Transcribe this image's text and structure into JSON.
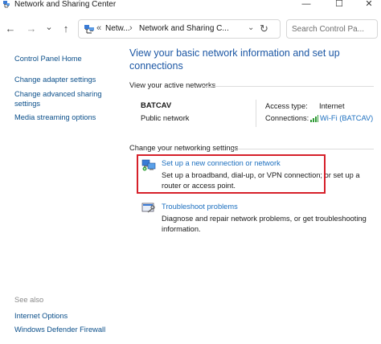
{
  "window": {
    "title": "Network and Sharing Center"
  },
  "window_controls": {
    "minimize": "—",
    "maximize": "☐",
    "close": "✕"
  },
  "nav": {
    "back": "←",
    "forward": "→",
    "recent": "⌄",
    "up": "↑"
  },
  "address": {
    "overflow": "«",
    "crumb1": "Netw...",
    "sep": "›",
    "crumb2": "Network and Sharing C...",
    "dropdown": "⌄",
    "refresh": "↻"
  },
  "search": {
    "placeholder": "Search Control Pa..."
  },
  "sidebar": {
    "items": [
      {
        "label": "Control Panel Home"
      },
      {
        "label": "Change adapter settings"
      },
      {
        "label": "Change advanced sharing settings"
      },
      {
        "label": "Media streaming options"
      }
    ],
    "see_also_title": "See also",
    "see_also": [
      {
        "label": "Internet Options"
      },
      {
        "label": "Windows Defender Firewall"
      }
    ]
  },
  "main": {
    "title": "View your basic network information and set up connections",
    "active_networks_label": "View your active networks",
    "network": {
      "name": "BATCAV",
      "type": "Public network",
      "access_type_label": "Access type:",
      "access_type_value": "Internet",
      "connections_label": "Connections:",
      "connections_value": "Wi-Fi (BATCAV)"
    },
    "change_settings_label": "Change your networking settings",
    "tasks": [
      {
        "link": "Set up a new connection or network",
        "desc": "Set up a broadband, dial-up, or VPN connection; or set up a router or access point."
      },
      {
        "link": "Troubleshoot problems",
        "desc": "Diagnose and repair network problems, or get troubleshooting information."
      }
    ]
  },
  "colors": {
    "link": "#1c6fbf",
    "title": "#1c57a4",
    "highlight": "#d6202a",
    "wifi": "#2f9a35"
  },
  "icons": [
    "network-center-icon",
    "back-arrow-icon",
    "forward-arrow-icon",
    "chevron-down-icon",
    "up-arrow-icon",
    "refresh-icon",
    "wifi-signal-icon",
    "new-connection-icon",
    "troubleshoot-icon"
  ]
}
